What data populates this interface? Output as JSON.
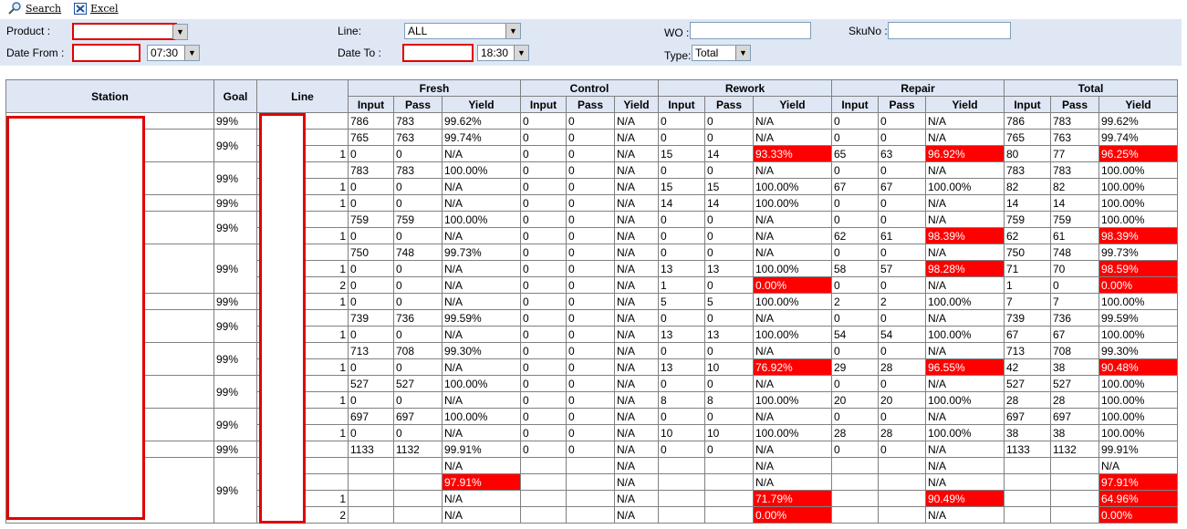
{
  "toolbar": {
    "search_label": "Search",
    "excel_label": "Excel"
  },
  "filters": {
    "product_label": "Product :",
    "line_label": "Line:",
    "line_value": "ALL",
    "wo_label": "WO :",
    "skuno_label": "SkuNo :",
    "date_from_label": "Date From :",
    "time_from": "07:30",
    "date_to_label": "Date To :",
    "time_to": "18:30",
    "type_label": "Type:",
    "type_value": "Total"
  },
  "table": {
    "headers": {
      "station": "Station",
      "goal": "Goal",
      "line": "Line"
    },
    "groups": [
      "Fresh",
      "Control",
      "Rework",
      "Repair",
      "Total"
    ],
    "subheaders": [
      "Input",
      "Pass",
      "Yield"
    ],
    "stations": [
      {
        "goal": "99%",
        "rows": [
          {
            "line": "",
            "cells": [
              "786",
              "783",
              "99.62%",
              "0",
              "0",
              "N/A",
              "0",
              "0",
              "N/A",
              "0",
              "0",
              "N/A",
              "786",
              "783",
              "99.62%"
            ],
            "red": []
          }
        ]
      },
      {
        "goal": "99%",
        "rows": [
          {
            "line": "",
            "cells": [
              "765",
              "763",
              "99.74%",
              "0",
              "0",
              "N/A",
              "0",
              "0",
              "N/A",
              "0",
              "0",
              "N/A",
              "765",
              "763",
              "99.74%"
            ],
            "red": []
          },
          {
            "line": "1",
            "cells": [
              "0",
              "0",
              "N/A",
              "0",
              "0",
              "N/A",
              "15",
              "14",
              "93.33%",
              "65",
              "63",
              "96.92%",
              "80",
              "77",
              "96.25%"
            ],
            "red": [
              8,
              11,
              14
            ]
          }
        ]
      },
      {
        "goal": "99%",
        "rows": [
          {
            "line": "",
            "cells": [
              "783",
              "783",
              "100.00%",
              "0",
              "0",
              "N/A",
              "0",
              "0",
              "N/A",
              "0",
              "0",
              "N/A",
              "783",
              "783",
              "100.00%"
            ],
            "red": []
          },
          {
            "line": "1",
            "cells": [
              "0",
              "0",
              "N/A",
              "0",
              "0",
              "N/A",
              "15",
              "15",
              "100.00%",
              "67",
              "67",
              "100.00%",
              "82",
              "82",
              "100.00%"
            ],
            "red": []
          }
        ]
      },
      {
        "goal": "99%",
        "rows": [
          {
            "line": "1",
            "cells": [
              "0",
              "0",
              "N/A",
              "0",
              "0",
              "N/A",
              "14",
              "14",
              "100.00%",
              "0",
              "0",
              "N/A",
              "14",
              "14",
              "100.00%"
            ],
            "red": []
          }
        ]
      },
      {
        "goal": "99%",
        "rows": [
          {
            "line": "",
            "cells": [
              "759",
              "759",
              "100.00%",
              "0",
              "0",
              "N/A",
              "0",
              "0",
              "N/A",
              "0",
              "0",
              "N/A",
              "759",
              "759",
              "100.00%"
            ],
            "red": []
          },
          {
            "line": "1",
            "cells": [
              "0",
              "0",
              "N/A",
              "0",
              "0",
              "N/A",
              "0",
              "0",
              "N/A",
              "62",
              "61",
              "98.39%",
              "62",
              "61",
              "98.39%"
            ],
            "red": [
              11,
              14
            ]
          }
        ]
      },
      {
        "goal": "99%",
        "rows": [
          {
            "line": "",
            "cells": [
              "750",
              "748",
              "99.73%",
              "0",
              "0",
              "N/A",
              "0",
              "0",
              "N/A",
              "0",
              "0",
              "N/A",
              "750",
              "748",
              "99.73%"
            ],
            "red": []
          },
          {
            "line": "1",
            "cells": [
              "0",
              "0",
              "N/A",
              "0",
              "0",
              "N/A",
              "13",
              "13",
              "100.00%",
              "58",
              "57",
              "98.28%",
              "71",
              "70",
              "98.59%"
            ],
            "red": [
              11,
              14
            ]
          },
          {
            "line": "2",
            "cells": [
              "0",
              "0",
              "N/A",
              "0",
              "0",
              "N/A",
              "1",
              "0",
              "0.00%",
              "0",
              "0",
              "N/A",
              "1",
              "0",
              "0.00%"
            ],
            "red": [
              8,
              14
            ]
          }
        ]
      },
      {
        "goal": "99%",
        "rows": [
          {
            "line": "1",
            "cells": [
              "0",
              "0",
              "N/A",
              "0",
              "0",
              "N/A",
              "5",
              "5",
              "100.00%",
              "2",
              "2",
              "100.00%",
              "7",
              "7",
              "100.00%"
            ],
            "red": []
          }
        ]
      },
      {
        "goal": "99%",
        "rows": [
          {
            "line": "",
            "cells": [
              "739",
              "736",
              "99.59%",
              "0",
              "0",
              "N/A",
              "0",
              "0",
              "N/A",
              "0",
              "0",
              "N/A",
              "739",
              "736",
              "99.59%"
            ],
            "red": []
          },
          {
            "line": "1",
            "cells": [
              "0",
              "0",
              "N/A",
              "0",
              "0",
              "N/A",
              "13",
              "13",
              "100.00%",
              "54",
              "54",
              "100.00%",
              "67",
              "67",
              "100.00%"
            ],
            "red": []
          }
        ]
      },
      {
        "goal": "99%",
        "rows": [
          {
            "line": "",
            "cells": [
              "713",
              "708",
              "99.30%",
              "0",
              "0",
              "N/A",
              "0",
              "0",
              "N/A",
              "0",
              "0",
              "N/A",
              "713",
              "708",
              "99.30%"
            ],
            "red": []
          },
          {
            "line": "1",
            "cells": [
              "0",
              "0",
              "N/A",
              "0",
              "0",
              "N/A",
              "13",
              "10",
              "76.92%",
              "29",
              "28",
              "96.55%",
              "42",
              "38",
              "90.48%"
            ],
            "red": [
              8,
              11,
              14
            ]
          }
        ]
      },
      {
        "goal": "99%",
        "rows": [
          {
            "line": "",
            "cells": [
              "527",
              "527",
              "100.00%",
              "0",
              "0",
              "N/A",
              "0",
              "0",
              "N/A",
              "0",
              "0",
              "N/A",
              "527",
              "527",
              "100.00%"
            ],
            "red": []
          },
          {
            "line": "1",
            "cells": [
              "0",
              "0",
              "N/A",
              "0",
              "0",
              "N/A",
              "8",
              "8",
              "100.00%",
              "20",
              "20",
              "100.00%",
              "28",
              "28",
              "100.00%"
            ],
            "red": []
          }
        ]
      },
      {
        "goal": "99%",
        "rows": [
          {
            "line": "",
            "cells": [
              "697",
              "697",
              "100.00%",
              "0",
              "0",
              "N/A",
              "0",
              "0",
              "N/A",
              "0",
              "0",
              "N/A",
              "697",
              "697",
              "100.00%"
            ],
            "red": []
          },
          {
            "line": "1",
            "cells": [
              "0",
              "0",
              "N/A",
              "0",
              "0",
              "N/A",
              "10",
              "10",
              "100.00%",
              "28",
              "28",
              "100.00%",
              "38",
              "38",
              "100.00%"
            ],
            "red": []
          }
        ]
      },
      {
        "goal": "99%",
        "rows": [
          {
            "line": "",
            "cells": [
              "1133",
              "1132",
              "99.91%",
              "0",
              "0",
              "N/A",
              "0",
              "0",
              "N/A",
              "0",
              "0",
              "N/A",
              "1133",
              "1132",
              "99.91%"
            ],
            "red": []
          }
        ]
      },
      {
        "goal": "99%",
        "rows": [
          {
            "line": "",
            "cells": [
              "",
              "",
              "N/A",
              "",
              "",
              "N/A",
              "",
              "",
              "N/A",
              "",
              "",
              "N/A",
              "",
              "",
              "N/A"
            ],
            "red": []
          },
          {
            "line": "",
            "cells": [
              "",
              "",
              "97.91%",
              "",
              "",
              "N/A",
              "",
              "",
              "N/A",
              "",
              "",
              "N/A",
              "",
              "",
              "97.91%"
            ],
            "red": [
              2,
              14
            ]
          },
          {
            "line": "1",
            "cells": [
              "",
              "",
              "N/A",
              "",
              "",
              "N/A",
              "",
              "",
              "71.79%",
              "",
              "",
              "90.49%",
              "",
              "",
              "64.96%"
            ],
            "red": [
              8,
              11,
              14
            ]
          },
          {
            "line": "2",
            "cells": [
              "",
              "",
              "N/A",
              "",
              "",
              "N/A",
              "",
              "",
              "0.00%",
              "",
              "",
              "N/A",
              "",
              "",
              "0.00%"
            ],
            "red": [
              8,
              14
            ]
          }
        ]
      }
    ]
  }
}
